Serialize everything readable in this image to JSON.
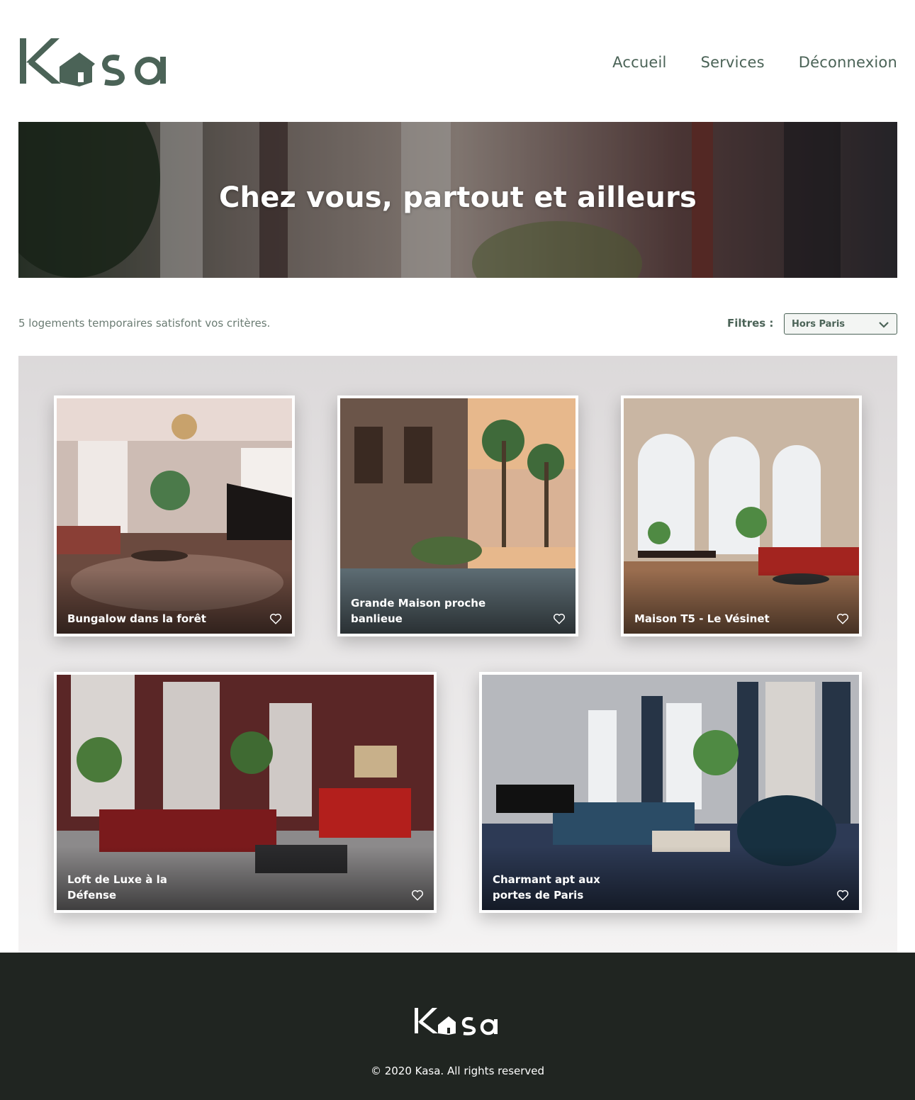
{
  "header": {
    "logo_text": "Kasa",
    "nav": [
      {
        "label": "Accueil"
      },
      {
        "label": "Services"
      },
      {
        "label": "Déconnexion"
      }
    ]
  },
  "banner": {
    "title": "Chez vous, partout et ailleurs"
  },
  "filters": {
    "results_text": "5 logements temporaires satisfont vos critères.",
    "label": "Filtres :",
    "selected": "Hors Paris"
  },
  "listings": [
    {
      "title": "Bungalow dans la forêt",
      "favorite_icon": "heart-outline"
    },
    {
      "title": "Grande Maison proche banlieue",
      "favorite_icon": "heart-outline"
    },
    {
      "title": "Maison T5 - Le Vésinet",
      "favorite_icon": "heart-outline"
    },
    {
      "title": "Loft de Luxe à la Défense",
      "favorite_icon": "heart-outline"
    },
    {
      "title": "Charmant apt aux portes de Paris",
      "favorite_icon": "heart-outline"
    }
  ],
  "footer": {
    "logo_text": "Kasa",
    "copyright": "© 2020 Kasa. All rights reserved"
  },
  "colors": {
    "brand": "#4b6357",
    "footer_bg": "#202521",
    "gallery_bg": "#dcd9da"
  }
}
